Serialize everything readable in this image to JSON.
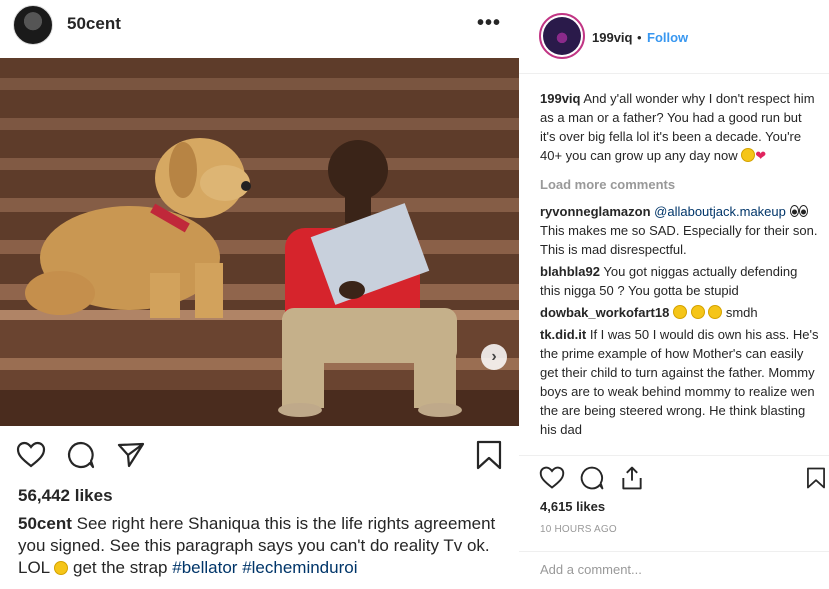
{
  "post": {
    "author": "50cent",
    "more_glyph": "•••",
    "likes": "56,442 likes",
    "caption_user": "50cent",
    "caption_text": "See right here Shaniqua this is the life rights agreement you signed. See this paragraph says you can't do reality Tv ok. LOL",
    "caption_tail": "get the strap",
    "caption_tag1": "#bellator",
    "caption_tag2": "#lecheminduroi",
    "carousel_glyph": "›"
  },
  "side": {
    "author": "199viq",
    "dot": "•",
    "follow": "Follow",
    "comments": [
      {
        "user": "199viq",
        "text": "And y'all wonder why I don't respect him as a man or a father? You had a good run but it's over big fella lol it's been a decade. You're 40+ you can grow up any day now"
      },
      {
        "user": "ryvonneglamazon",
        "mention": "@allaboutjack.makeup",
        "text": "This makes me so SAD. Especially for their son. This is mad disrespectful."
      },
      {
        "user": "blahbla92",
        "text": "You got niggas actually defending this nigga 50 ? You gotta be stupid"
      },
      {
        "user": "dowbak_workofart18",
        "text": "smdh"
      },
      {
        "user": "tk.did.it",
        "text": "If I was 50 I would dis own his ass. He's the prime example of how Mother's can easily get their child to turn against the father. Mommy boys are to weak behind mommy to realize wen the are being steered wrong. He think blasting his dad"
      }
    ],
    "load_more": "Load more comments",
    "likes": "4,615 likes",
    "time": "10 HOURS AGO",
    "comment_placeholder": "Add a comment..."
  },
  "colors": {
    "link": "#3897f0",
    "hashtag": "#003569",
    "muted": "#999999",
    "story_ring": "#c13584"
  },
  "icons": [
    "heart-icon",
    "comment-icon",
    "share-icon",
    "bookmark-icon",
    "carousel-next-icon",
    "more-icon"
  ]
}
